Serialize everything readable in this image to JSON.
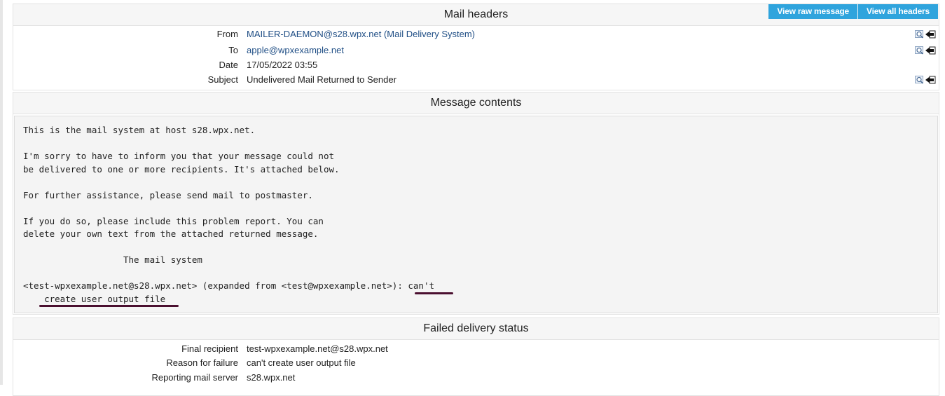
{
  "headers": {
    "title": "Mail headers",
    "buttons": {
      "view_raw": "View raw message",
      "view_all": "View all headers"
    },
    "rows": [
      {
        "label": "From",
        "value": "MAILER-DAEMON@s28.wpx.net (Mail Delivery System)",
        "link": true,
        "icons": true
      },
      {
        "label": "To",
        "value": "apple@wpxexample.net",
        "link": true,
        "icons": true
      },
      {
        "label": "Date",
        "value": "17/05/2022 03:55",
        "link": false,
        "icons": false
      },
      {
        "label": "Subject",
        "value": "Undelivered Mail Returned to Sender",
        "link": false,
        "icons": true
      }
    ]
  },
  "contents": {
    "title": "Message contents",
    "body_text": "This is the mail system at host s28.wpx.net.\n\nI'm sorry to have to inform you that your message could not\nbe delivered to one or more recipients. It's attached below.\n\nFor further assistance, please send mail to postmaster.\n\nIf you do so, please include this problem report. You can\ndelete your own text from the attached returned message.\n\n                   The mail system\n\n<test-wpxexample.net@s28.wpx.net> (expanded from <test@wpxexample.net>): can't\n    create user output file"
  },
  "status": {
    "title": "Failed delivery status",
    "rows": [
      {
        "label": "Final recipient",
        "value": "test-wpxexample.net@s28.wpx.net"
      },
      {
        "label": "Reason for failure",
        "value": "can't create user output file"
      },
      {
        "label": "Reporting mail server",
        "value": "s28.wpx.net"
      }
    ]
  },
  "colors": {
    "accent": "#2fa4dd",
    "link": "#1f4e85",
    "annotation": "#4a0f2f"
  },
  "icon_names": [
    "search-icon",
    "back-arrow-icon"
  ]
}
